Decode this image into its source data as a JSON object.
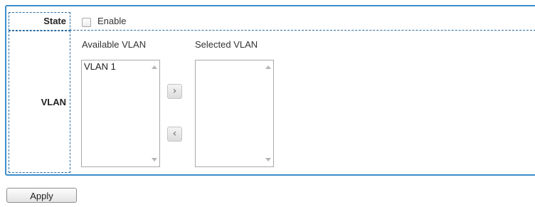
{
  "state": {
    "label": "State",
    "enable_label": "Enable",
    "enabled": false
  },
  "vlan": {
    "label": "VLAN",
    "available_title": "Available VLAN",
    "selected_title": "Selected VLAN",
    "available_items": [
      "VLAN 1"
    ],
    "selected_items": [],
    "add_icon": "chevron-right-icon",
    "remove_icon": "chevron-left-icon"
  },
  "apply_label": "Apply",
  "colors": {
    "panel_border": "#3c8dcb",
    "label_border": "#2b6ea3"
  }
}
